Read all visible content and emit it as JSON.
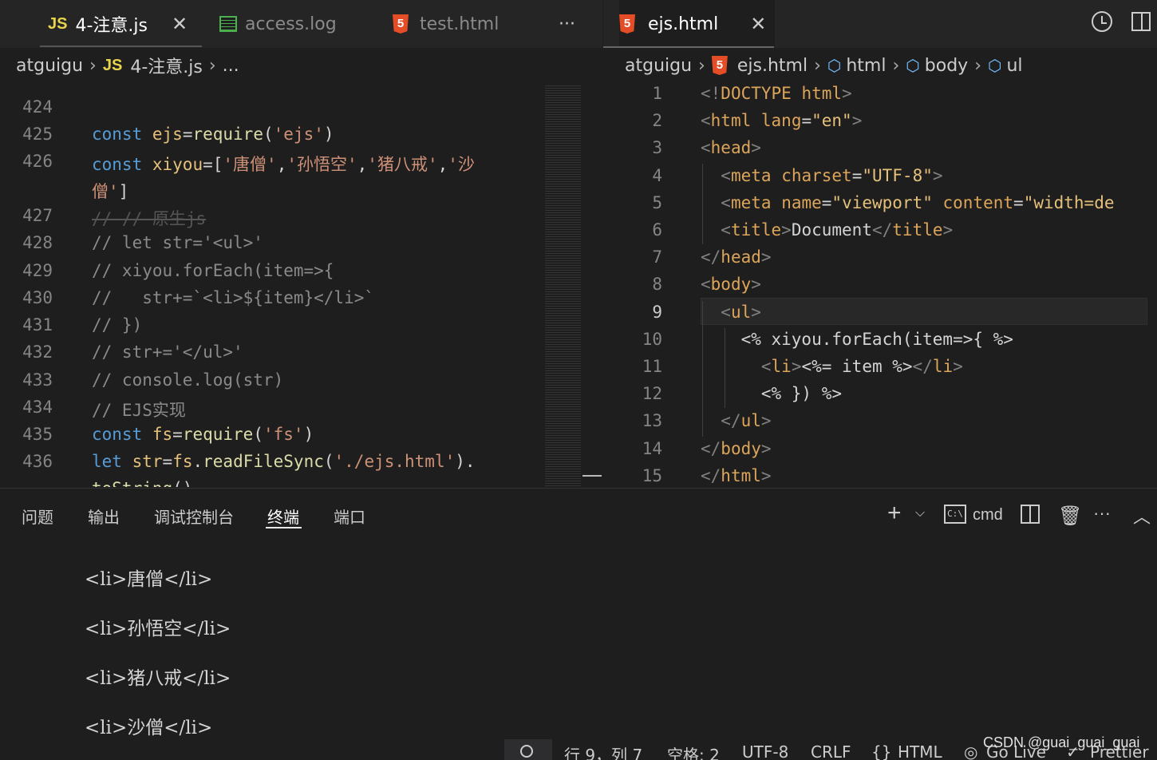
{
  "left_tabs": [
    {
      "label": "4-注意.js",
      "icon": "js-icon",
      "active": true
    },
    {
      "label": "access.log",
      "icon": "log-icon",
      "active": false
    },
    {
      "label": "test.html",
      "icon": "html5-icon",
      "active": false
    }
  ],
  "left_more": "···",
  "right_tab": {
    "label": "ejs.html",
    "icon": "html5-icon"
  },
  "left_breadcrumb": {
    "folder": "atguigu",
    "file": "4-注意.js",
    "more": "..."
  },
  "right_breadcrumb": {
    "folder": "atguigu",
    "file": "ejs.html",
    "path": [
      "html",
      "body",
      "ul"
    ]
  },
  "left_code": {
    "lines": [
      {
        "n": "424",
        "text": ""
      },
      {
        "n": "425",
        "text": "const ejs=require('ejs')"
      },
      {
        "n": "426",
        "text": "const xiyou=['唐僧','孙悟空','猪八戒','沙"
      },
      {
        "n": "",
        "text": "僧']"
      },
      {
        "n": "427",
        "text": "// // 原生js"
      },
      {
        "n": "428",
        "text": "// let str='<ul>'"
      },
      {
        "n": "429",
        "text": "// xiyou.forEach(item=>{"
      },
      {
        "n": "430",
        "text": "//   str+=`<li>${item}</li>`"
      },
      {
        "n": "431",
        "text": "// })"
      },
      {
        "n": "432",
        "text": "// str+='</ul>'"
      },
      {
        "n": "433",
        "text": "// console.log(str)"
      },
      {
        "n": "434",
        "text": "// EJS实现"
      },
      {
        "n": "435",
        "text": "const fs=require('fs')"
      },
      {
        "n": "436",
        "text": "let str=fs.readFileSync('./ejs.html')."
      },
      {
        "n": "",
        "text": "toString()"
      }
    ]
  },
  "right_code": {
    "current_line": "9",
    "lines": [
      {
        "n": "1",
        "text": "<!DOCTYPE html>"
      },
      {
        "n": "2",
        "text": "<html lang=\"en\">"
      },
      {
        "n": "3",
        "text": "<head>"
      },
      {
        "n": "4",
        "text": "  <meta charset=\"UTF-8\">"
      },
      {
        "n": "5",
        "text": "  <meta name=\"viewport\" content=\"width=de"
      },
      {
        "n": "6",
        "text": "  <title>Document</title>"
      },
      {
        "n": "7",
        "text": "</head>"
      },
      {
        "n": "8",
        "text": "<body>"
      },
      {
        "n": "9",
        "text": "  <ul>"
      },
      {
        "n": "10",
        "text": "    <% xiyou.forEach(item=>{ %>"
      },
      {
        "n": "11",
        "text": "      <li><%= item %></li>"
      },
      {
        "n": "12",
        "text": "      <% }) %>"
      },
      {
        "n": "13",
        "text": "  </ul>"
      },
      {
        "n": "14",
        "text": "</body>"
      },
      {
        "n": "15",
        "text": "</html>"
      }
    ]
  },
  "panel": {
    "tabs": [
      "问题",
      "输出",
      "调试控制台",
      "终端",
      "端口"
    ],
    "active": "终端",
    "terminal_name": "cmd",
    "output": [
      "<li>唐僧</li>",
      "<li>孙悟空</li>",
      "<li>猪八戒</li>",
      "<li>沙僧</li>"
    ]
  },
  "status": {
    "position": "行 9，列 7",
    "spaces": "空格: 2",
    "encoding": "UTF-8",
    "eol": "CRLF",
    "language": "HTML",
    "golive": "Go Live",
    "prettier": "Prettier"
  },
  "watermark": "CSDN @guai_guai_guai"
}
